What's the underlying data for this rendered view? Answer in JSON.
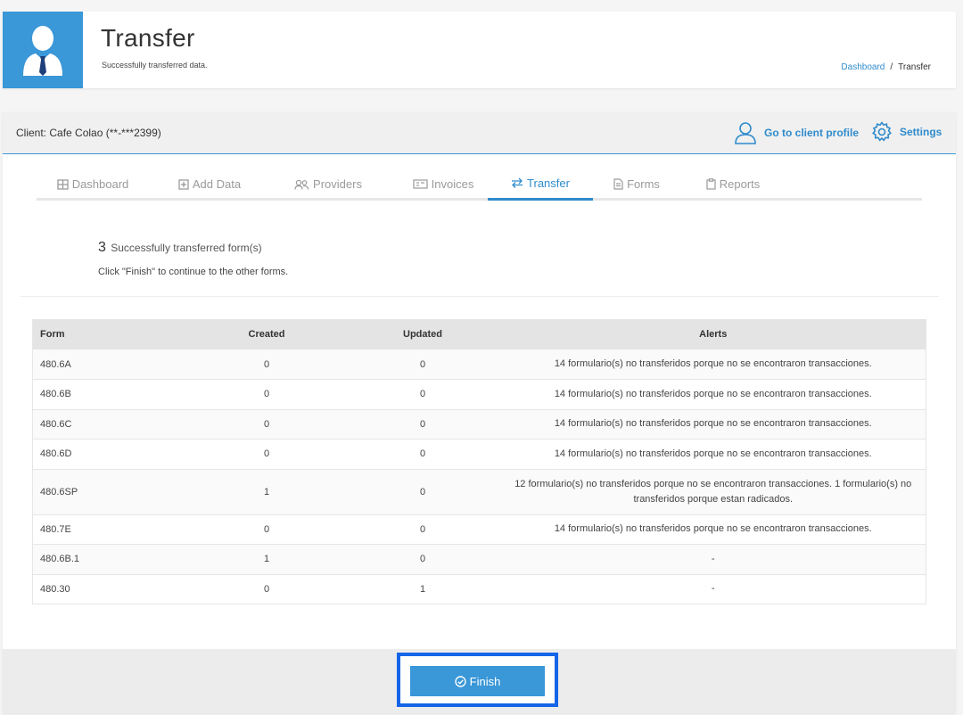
{
  "header": {
    "title": "Transfer",
    "subtitle": "Successfully transferred data.",
    "breadcrumb": {
      "home": "Dashboard",
      "separator": "/",
      "current": "Transfer"
    }
  },
  "client_bar": {
    "label_prefix": "Client:",
    "client_name": "Cafe Colao (**-***2399)",
    "profile_link": "Go to client profile",
    "settings_link": "Settings"
  },
  "tabs": [
    {
      "label": "Dashboard",
      "icon": "grid-icon",
      "active": false
    },
    {
      "label": "Add Data",
      "icon": "plus-square-icon",
      "active": false
    },
    {
      "label": "Providers",
      "icon": "users-icon",
      "active": false
    },
    {
      "label": "Invoices",
      "icon": "invoice-icon",
      "active": false
    },
    {
      "label": "Transfer",
      "icon": "transfer-icon",
      "active": true
    },
    {
      "label": "Forms",
      "icon": "document-icon",
      "active": false
    },
    {
      "label": "Reports",
      "icon": "clipboard-icon",
      "active": false
    }
  ],
  "summary": {
    "count": "3",
    "text": "Successfully transferred form(s)",
    "instruction": "Click \"Finish\" to continue to the other forms."
  },
  "table": {
    "headers": {
      "form": "Form",
      "created": "Created",
      "updated": "Updated",
      "alerts": "Alerts"
    },
    "rows": [
      {
        "form": "480.6A",
        "created": "0",
        "updated": "0",
        "alerts": "14 formulario(s) no transferidos porque no se encontraron transacciones."
      },
      {
        "form": "480.6B",
        "created": "0",
        "updated": "0",
        "alerts": "14 formulario(s) no transferidos porque no se encontraron transacciones."
      },
      {
        "form": "480.6C",
        "created": "0",
        "updated": "0",
        "alerts": "14 formulario(s) no transferidos porque no se encontraron transacciones."
      },
      {
        "form": "480.6D",
        "created": "0",
        "updated": "0",
        "alerts": "14 formulario(s) no transferidos porque no se encontraron transacciones."
      },
      {
        "form": "480.6SP",
        "created": "1",
        "updated": "0",
        "alerts": "12 formulario(s) no transferidos porque no se encontraron transacciones. 1 formulario(s) no transferidos porque estan radicados."
      },
      {
        "form": "480.7E",
        "created": "0",
        "updated": "0",
        "alerts": "14 formulario(s) no transferidos porque no se encontraron transacciones."
      },
      {
        "form": "480.6B.1",
        "created": "1",
        "updated": "0",
        "alerts": "-"
      },
      {
        "form": "480.30",
        "created": "0",
        "updated": "1",
        "alerts": "-"
      }
    ]
  },
  "footer": {
    "finish_label": "Finish"
  },
  "colors": {
    "accent": "#3a97d8",
    "highlight": "#1565e8"
  }
}
